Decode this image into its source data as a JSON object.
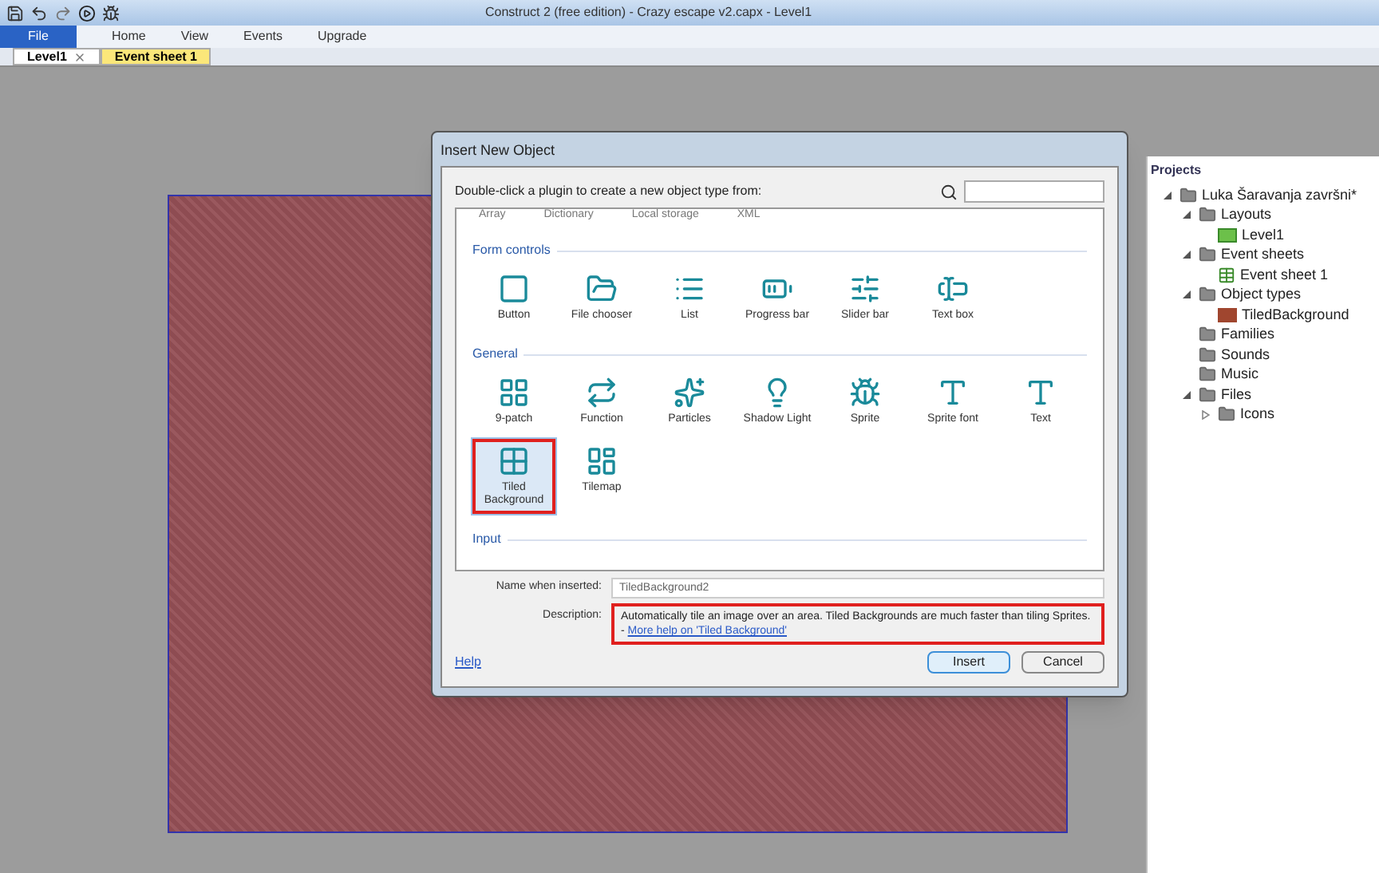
{
  "title_bar": {
    "title": "Construct 2  (free edition) - Crazy escape v2.capx - Level1"
  },
  "file_button": "File",
  "ribbon_tabs": [
    "Home",
    "View",
    "Events",
    "Upgrade"
  ],
  "document_tabs": [
    {
      "label": "Level1",
      "selected": true,
      "closable": true
    },
    {
      "label": "Event sheet 1",
      "selected": false,
      "closable": false
    }
  ],
  "dialog": {
    "title": "Insert New Object",
    "prompt": "Double-click a plugin to create a new object type from:",
    "partial_row": [
      "Array",
      "Dictionary",
      "Local storage",
      "XML"
    ],
    "sections": [
      {
        "title": "Form controls",
        "items": [
          {
            "label": "Button",
            "kind": "button",
            "selected": false
          },
          {
            "label": "File chooser",
            "kind": "file",
            "selected": false
          },
          {
            "label": "List",
            "kind": "list",
            "selected": false
          },
          {
            "label": "Progress bar",
            "kind": "progress",
            "selected": false
          },
          {
            "label": "Slider bar",
            "kind": "slider",
            "selected": false
          },
          {
            "label": "Text box",
            "kind": "textbox",
            "selected": false
          }
        ]
      },
      {
        "title": "General",
        "items": [
          {
            "label": "9-patch",
            "kind": "ninepatch",
            "selected": false
          },
          {
            "label": "Function",
            "kind": "function",
            "selected": false
          },
          {
            "label": "Particles",
            "kind": "particles",
            "selected": false
          },
          {
            "label": "Shadow Light",
            "kind": "light",
            "selected": false
          },
          {
            "label": "Sprite",
            "kind": "sprite",
            "selected": false
          },
          {
            "label": "Sprite font",
            "kind": "spritefont",
            "selected": false
          },
          {
            "label": "Text",
            "kind": "text",
            "selected": false
          },
          {
            "label": "Tiled Background",
            "kind": "tiled",
            "selected": true
          },
          {
            "label": "Tilemap",
            "kind": "tilemap",
            "selected": false
          }
        ]
      },
      {
        "title": "Input"
      }
    ],
    "name_field": {
      "label": "Name when inserted:",
      "value": "TiledBackground2"
    },
    "description": {
      "label": "Description:",
      "text": "Automatically tile an image over an area.  Tiled Backgrounds are much faster than tiling Sprites. -",
      "link": "More help on 'Tiled Background'"
    },
    "help": "Help",
    "buttons": [
      {
        "label": "Insert",
        "default": true
      },
      {
        "label": "Cancel",
        "default": false
      }
    ]
  },
  "projects": {
    "title": "Projects",
    "tree": [
      {
        "label": "Luka  Šaravanja završni*",
        "kind": "folder",
        "expanded": true,
        "children": [
          {
            "label": "Layouts",
            "kind": "folder",
            "expanded": true,
            "children": [
              {
                "label": "Level1",
                "kind": "layout"
              }
            ]
          },
          {
            "label": "Event sheets",
            "kind": "folder",
            "expanded": true,
            "children": [
              {
                "label": "Event sheet 1",
                "kind": "eventsheet"
              }
            ]
          },
          {
            "label": "Object types",
            "kind": "folder",
            "expanded": true,
            "children": [
              {
                "label": "TiledBackground",
                "kind": "object"
              }
            ]
          },
          {
            "label": "Families",
            "kind": "folder"
          },
          {
            "label": "Sounds",
            "kind": "folder"
          },
          {
            "label": "Music",
            "kind": "folder"
          },
          {
            "label": "Files",
            "kind": "folder",
            "expanded": true,
            "children": [
              {
                "label": "Icons",
                "kind": "folder",
                "expanded": false
              }
            ]
          }
        ]
      }
    ]
  }
}
